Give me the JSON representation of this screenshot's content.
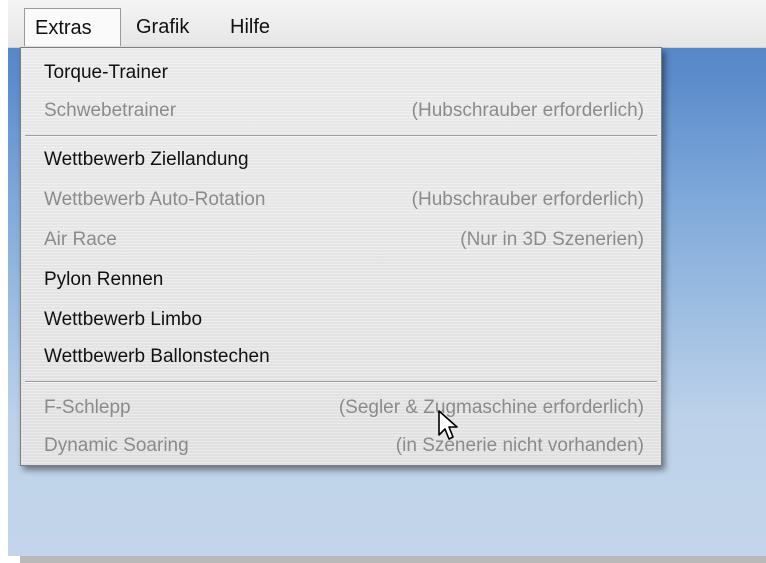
{
  "menubar": {
    "items": [
      {
        "label": "Extras"
      },
      {
        "label": "Grafik"
      },
      {
        "label": "Hilfe"
      }
    ]
  },
  "menu": {
    "items": [
      {
        "label": "Torque-Trainer",
        "note": "",
        "enabled": true
      },
      {
        "label": "Schwebetrainer",
        "note": "(Hubschrauber erforderlich)",
        "enabled": false
      },
      {
        "label": "Wettbewerb Ziellandung",
        "note": "",
        "enabled": true
      },
      {
        "label": "Wettbewerb Auto-Rotation",
        "note": "(Hubschrauber erforderlich)",
        "enabled": false
      },
      {
        "label": "Air Race",
        "note": "(Nur in 3D Szenerien)",
        "enabled": false
      },
      {
        "label": "Pylon Rennen",
        "note": "",
        "enabled": true
      },
      {
        "label": "Wettbewerb Limbo",
        "note": "",
        "enabled": true
      },
      {
        "label": "Wettbewerb Ballonstechen",
        "note": "",
        "enabled": true
      },
      {
        "label": "F-Schlepp",
        "note": "(Segler & Zugmaschine erforderlich)",
        "enabled": false
      },
      {
        "label": "Dynamic Soaring",
        "note": "(in Szenerie nicht vorhanden)",
        "enabled": false
      }
    ]
  },
  "icons": {
    "cursor": "mouse-pointer-icon"
  }
}
